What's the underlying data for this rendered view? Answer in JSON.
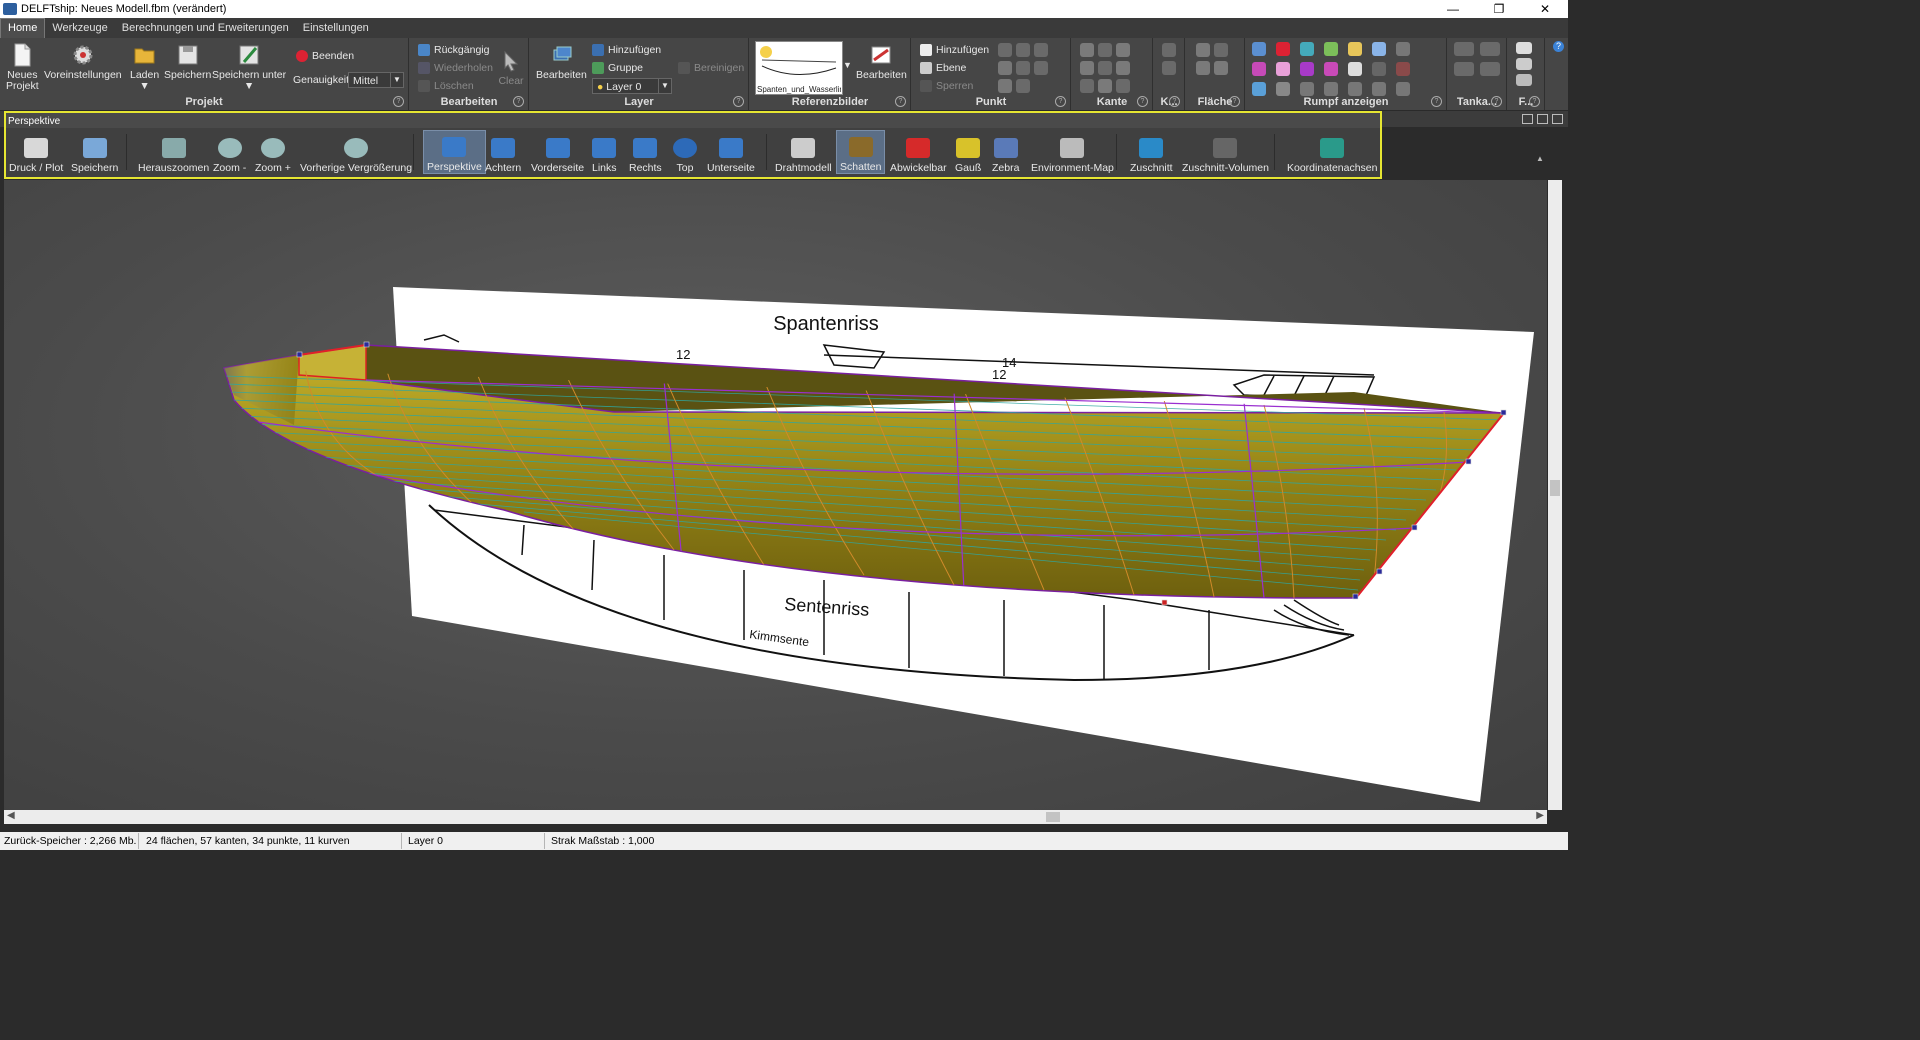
{
  "window": {
    "title": "DELFTship: Neues Modell.fbm (verändert)"
  },
  "menu": {
    "tabs": [
      "Home",
      "Werkzeuge",
      "Berechnungen und Erweiterungen",
      "Einstellungen"
    ]
  },
  "ribbon": {
    "projekt": {
      "label": "Projekt",
      "neues_projekt": "Neues\nProjekt",
      "voreinstellungen": "Voreinstellungen",
      "laden": "Laden",
      "speichern": "Speichern",
      "speichern_unter": "Speichern unter",
      "beenden": "Beenden",
      "genauigkeit_label": "Genauigkeit",
      "genauigkeit_value": "Mittel"
    },
    "bearbeiten": {
      "label": "Bearbeiten",
      "rueckgaengig": "Rückgängig",
      "wiederholen": "Wiederholen",
      "loeschen": "Löschen",
      "clear": "Clear"
    },
    "layer": {
      "label": "Layer",
      "bearbeiten": "Bearbeiten",
      "hinzufuegen": "Hinzufügen",
      "gruppe": "Gruppe",
      "bereinigen": "Bereinigen",
      "current_layer": "Layer 0"
    },
    "referenzbilder": {
      "label": "Referenzbilder",
      "thumbnail_caption": "Spanten_und_Wasserlini...",
      "bearbeiten": "Bearbeiten"
    },
    "punkt": {
      "label": "Punkt",
      "hinzufuegen": "Hinzufügen",
      "ebene": "Ebene",
      "sperren": "Sperren"
    },
    "kante": {
      "label": "Kante"
    },
    "k": {
      "label": "K..."
    },
    "flaeche": {
      "label": "Fläche"
    },
    "rumpf": {
      "label": "Rumpf anzeigen"
    },
    "tanka": {
      "label": "Tanka..."
    },
    "f": {
      "label": "F..."
    }
  },
  "perspektive": {
    "title": "Perspektive",
    "buttons": [
      {
        "label": "Druck / Plot",
        "icon": "printer-icon"
      },
      {
        "label": "Speichern",
        "icon": "save-view-icon"
      },
      {
        "label": "Herauszoomen",
        "icon": "zoom-extents-icon"
      },
      {
        "label": "Zoom -",
        "icon": "zoom-out-icon"
      },
      {
        "label": "Zoom +",
        "icon": "zoom-in-icon"
      },
      {
        "label": "Vorherige Vergrößerung",
        "icon": "previous-zoom-icon"
      },
      {
        "label": "Perspektive",
        "icon": "perspective-view-icon"
      },
      {
        "label": "Achtern",
        "icon": "aft-view-icon"
      },
      {
        "label": "Vorderseite",
        "icon": "front-view-icon"
      },
      {
        "label": "Links",
        "icon": "left-view-icon"
      },
      {
        "label": "Rechts",
        "icon": "right-view-icon"
      },
      {
        "label": "Top",
        "icon": "top-view-icon"
      },
      {
        "label": "Unterseite",
        "icon": "bottom-view-icon"
      },
      {
        "label": "Drahtmodell",
        "icon": "wireframe-icon"
      },
      {
        "label": "Schatten",
        "icon": "shade-icon"
      },
      {
        "label": "Abwickelbar",
        "icon": "developable-icon"
      },
      {
        "label": "Gauß",
        "icon": "gauss-icon"
      },
      {
        "label": "Zebra",
        "icon": "zebra-icon"
      },
      {
        "label": "Environment-Map",
        "icon": "environment-map-icon"
      },
      {
        "label": "Zuschnitt",
        "icon": "cutout-icon"
      },
      {
        "label": "Zuschnitt-Volumen",
        "icon": "cutout-volume-icon"
      },
      {
        "label": "Koordinatenachsen",
        "icon": "coordinate-axes-icon"
      }
    ]
  },
  "viewport": {
    "ref_title": "Spantenriss",
    "ref_sentenriss": "Sentenriss",
    "ref_kimmsente": "Kimmsente",
    "ref_n12a": "12",
    "ref_n14": "14",
    "ref_n12b": "12",
    "colors": {
      "hull": "#8a7a10",
      "hull_light": "#b7a422",
      "waterline": "#2fa7a0",
      "station": "#d08a2a",
      "control": "#9a2fd0",
      "edge": "#e0202a"
    }
  },
  "status": {
    "undo_memory": "Zurück-Speicher : 2,266 Mb.",
    "counts": "24 flächen, 57 kanten, 34 punkte, 11 kurven",
    "layer": "Layer 0",
    "strak": "Strak Maßstab : 1,000"
  }
}
